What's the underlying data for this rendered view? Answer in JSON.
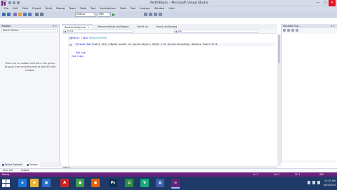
{
  "window": {
    "title": "TestVBSync - Microsoft Visual Studio",
    "minimize_glyph": "—",
    "maximize_glyph": "☐",
    "close_glyph": "✕"
  },
  "menu": [
    "File",
    "Edit",
    "View",
    "Project",
    "Build",
    "Debug",
    "Team",
    "Tools",
    "Test",
    "Architecture",
    "Tools",
    "Test",
    "Analyze",
    "Window",
    "Help"
  ],
  "toolbar": {
    "config": "Debug",
    "platform": "x86",
    "start_label": "Start"
  },
  "toolbox": {
    "title": "Toolbox",
    "pin_glyph": "▾ ✕",
    "search_placeholder": "Search Toolbox",
    "message": "There are no usable controls in this group. Drag an item onto this text to add it to the toolbox."
  },
  "tabs": [
    {
      "label": "ResourceVbSyb.vb",
      "active": true,
      "close_glyph": "✕"
    },
    {
      "label": "ResourceVbSyb.vb [Design]",
      "active": false,
      "close_glyph": ""
    },
    {
      "label": "Form1.vb",
      "active": false,
      "close_glyph": ""
    },
    {
      "label": "Form1.vb [Design]",
      "active": false,
      "close_glyph": ""
    }
  ],
  "navbar": {
    "left": "Form1",
    "right": "Sub"
  },
  "code": {
    "line1_kw": "Public Class",
    "line1_name": " ResourceVbSyb",
    "line2_kw": "Private Sub",
    "line2_rest": " Timer1_Tick_1(ByVal sender As System.Object, ByVal e As System.EventArgs) Handles Timer1.Tick",
    "line3": "End Sub",
    "line4": "End Class"
  },
  "editor": {
    "zoom": "100 %"
  },
  "solution": {
    "title": "Solution Exp..."
  },
  "bottom_tabs": [
    {
      "label": "Server Explorer",
      "active": false
    },
    {
      "label": "Toolbox",
      "active": true
    }
  ],
  "errorlist": {
    "left": "Error List",
    "output": "Output"
  },
  "status": {
    "left": "Ready",
    "ln": "Ln 1",
    "col": "Col 1",
    "ch": "Ch 1",
    "ins": "INS"
  },
  "taskbar": {
    "icons": [
      {
        "name": "ie-icon",
        "glyph": "e",
        "color": "#1e73d8"
      },
      {
        "name": "file-explorer-icon",
        "glyph": "▬",
        "color": "#e8b43a"
      },
      {
        "name": "store-icon",
        "glyph": "▣",
        "color": "#2c6ec7"
      },
      {
        "name": "acrobat-icon",
        "glyph": "A",
        "color": "#c9262b"
      },
      {
        "name": "chrome-icon",
        "glyph": "●",
        "color": "#3f9b4b"
      },
      {
        "name": "firefox-icon",
        "glyph": "●",
        "color": "#e66000"
      },
      {
        "name": "photoshop-icon",
        "glyph": "Ps",
        "color": "#0e2f52"
      },
      {
        "name": "app-icon-green",
        "glyph": "▤",
        "color": "#2b8a3e"
      },
      {
        "name": "vine-icon",
        "glyph": "V",
        "color": "#1aa87a"
      },
      {
        "name": "app-icon-2",
        "glyph": "▦",
        "color": "#3b5fa8"
      },
      {
        "name": "visual-studio-icon",
        "glyph": "∞",
        "color": "#68217a"
      }
    ],
    "time": "12:35 AM",
    "date": "9/25/2015"
  },
  "colors": {
    "accent": "#68217a",
    "taskbar": "#1f3a68",
    "keyword": "#0000ff",
    "type": "#2b91af"
  }
}
